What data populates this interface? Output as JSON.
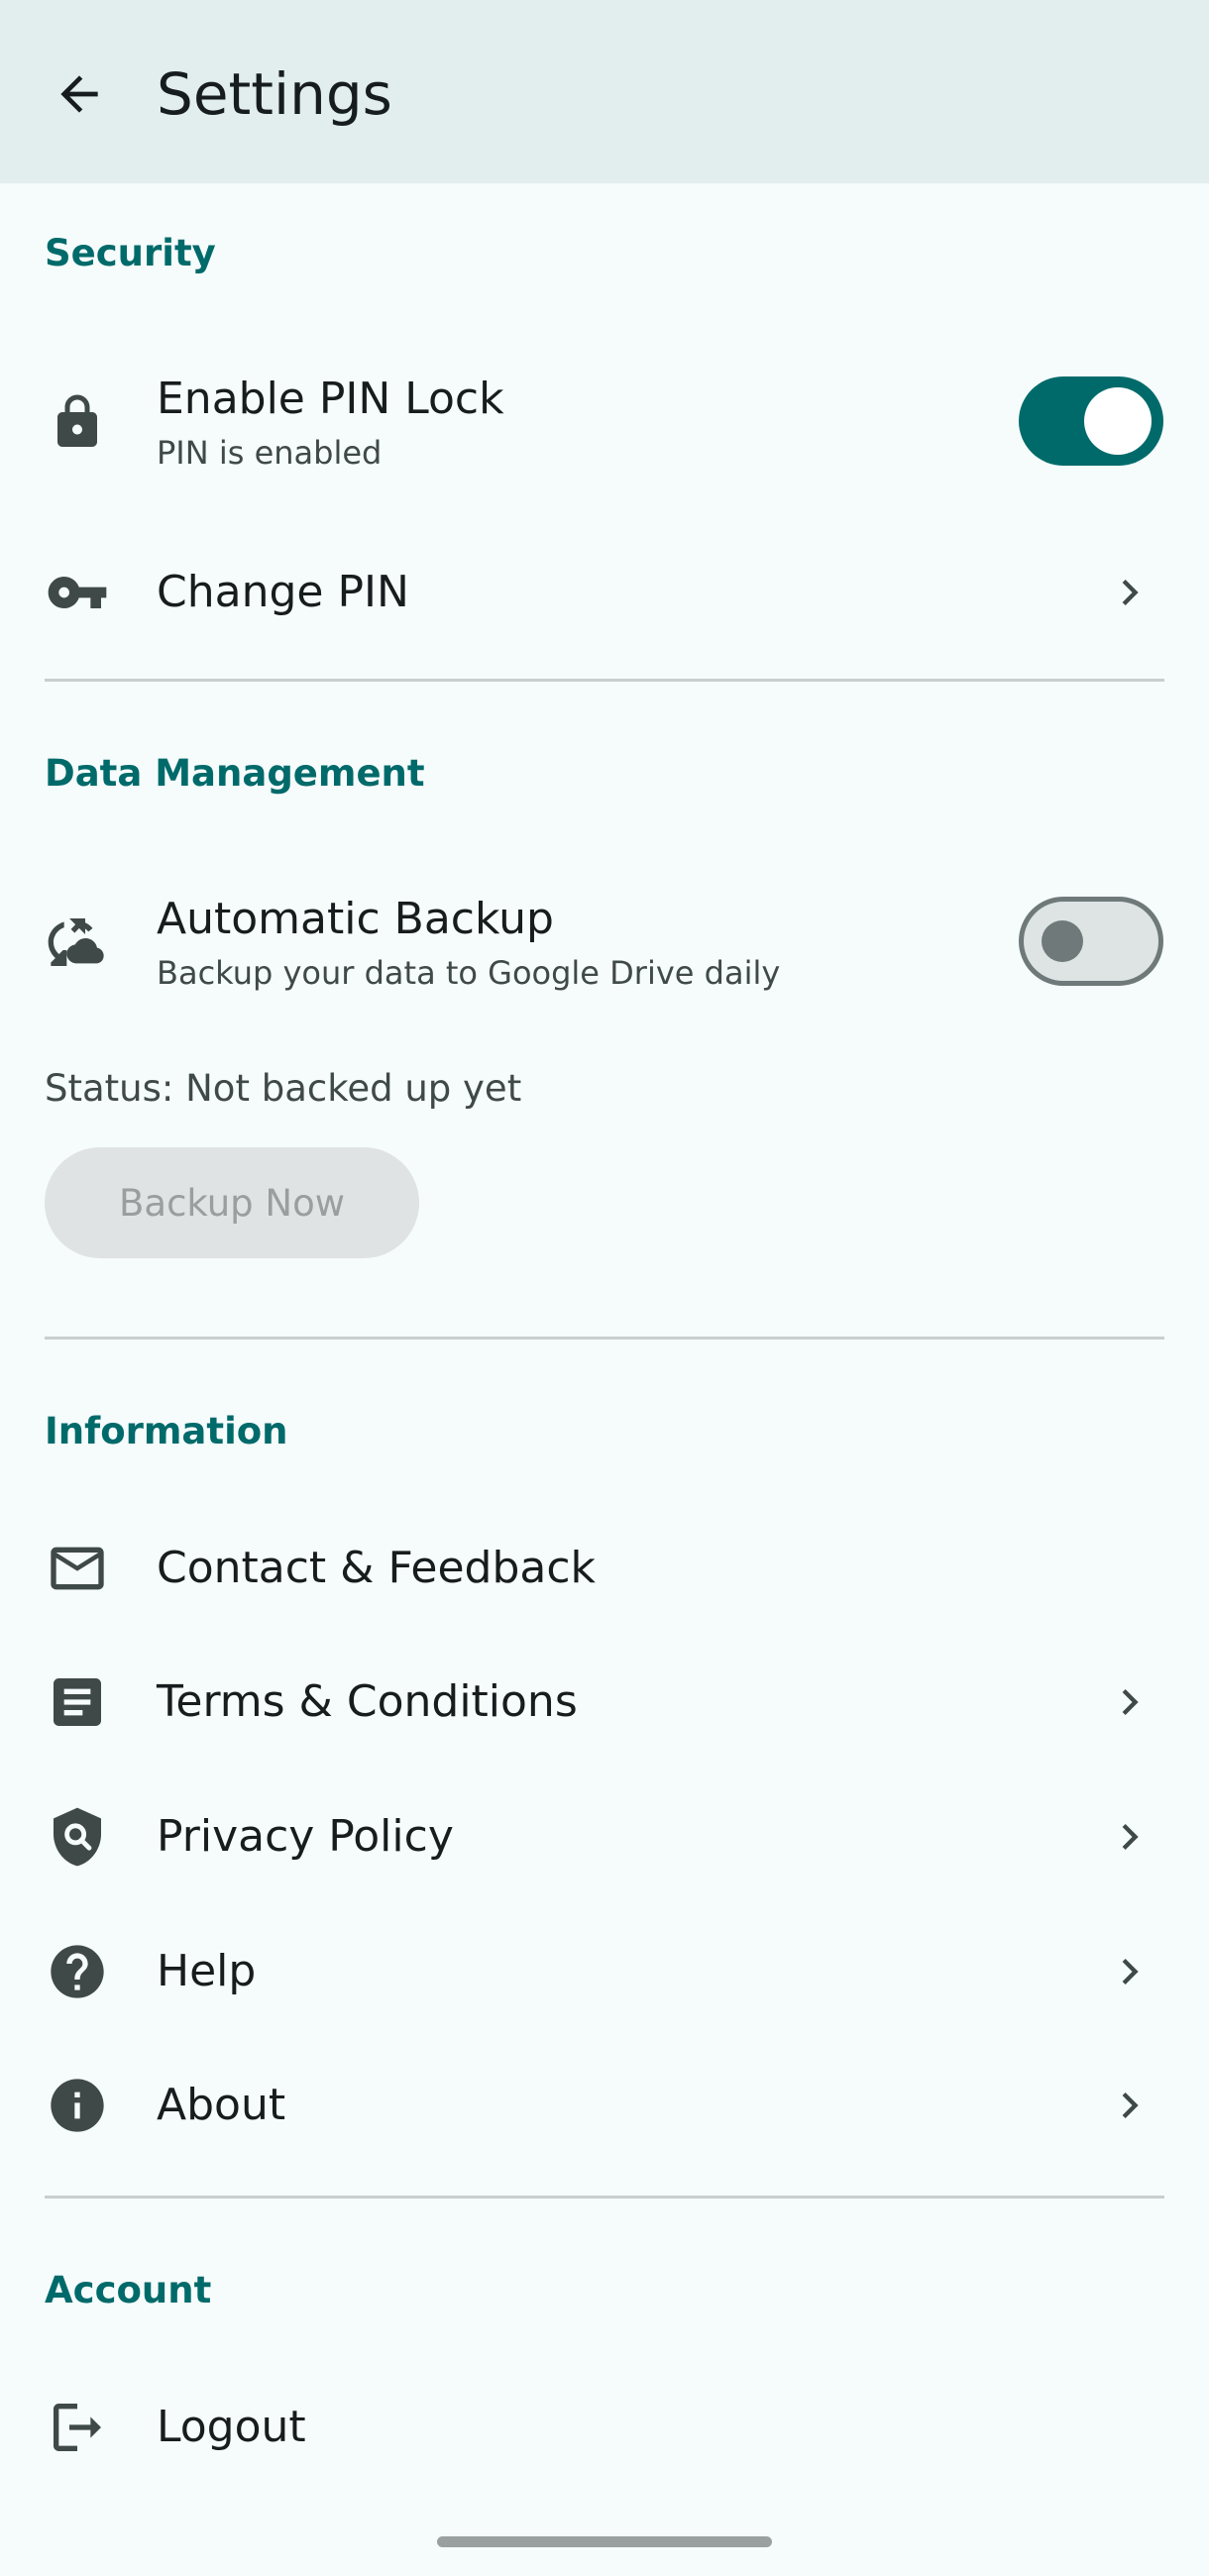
{
  "app_bar": {
    "title": "Settings",
    "back_icon": "arrow-back-icon"
  },
  "sections": {
    "security": {
      "header": "Security",
      "enable_pin": {
        "label": "Enable PIN Lock",
        "subtitle": "PIN is enabled",
        "icon": "lock-icon",
        "enabled": true
      },
      "change_pin": {
        "label": "Change PIN",
        "icon": "key-icon"
      }
    },
    "data_management": {
      "header": "Data Management",
      "auto_backup": {
        "label": "Automatic Backup",
        "subtitle": "Backup your data to Google Drive daily",
        "icon": "cloud-sync-icon",
        "enabled": false
      },
      "status": "Status: Not backed up yet",
      "backup_button": "Backup Now"
    },
    "information": {
      "header": "Information",
      "items": [
        {
          "label": "Contact & Feedback",
          "icon": "mail-icon"
        },
        {
          "label": "Terms & Conditions",
          "icon": "document-icon"
        },
        {
          "label": "Privacy Policy",
          "icon": "privacy-shield-icon"
        },
        {
          "label": "Help",
          "icon": "help-icon"
        },
        {
          "label": "About",
          "icon": "info-icon"
        }
      ]
    },
    "account": {
      "header": "Account",
      "logout": {
        "label": "Logout",
        "icon": "logout-icon"
      }
    }
  },
  "colors": {
    "accent": "#006a6a",
    "app_bar_bg": "#e2eded",
    "background": "#f6fbfc",
    "icon": "#3f4948"
  }
}
